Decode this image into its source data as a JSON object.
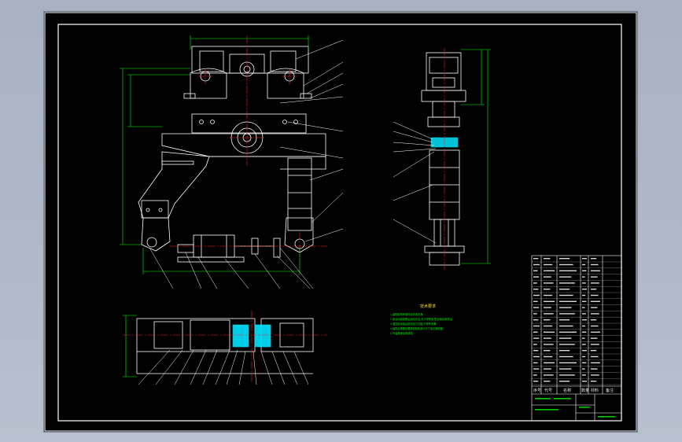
{
  "canvas": {
    "background": "#a9b3c4",
    "sheet_color": "#000000",
    "colors": {
      "outline": "#ffffff",
      "center_line": "#ff2020",
      "dimension": "#00ff00",
      "leader": "#ffffff",
      "hatch": "#00e5ff",
      "note_title": "#ffe000",
      "note_text": "#00ff00"
    }
  },
  "views": [
    {
      "name": "front-view"
    },
    {
      "name": "side-view"
    },
    {
      "name": "top-view"
    }
  ],
  "technical_notes": {
    "title": "技术要求",
    "lines": [
      "1.装配前所有零件应清洗干净。",
      "2.各运动副装配后运动灵活,无卡滞现象,配合面涂润滑油。",
      "3.液压缸安装后进行压力试验,不得有渗漏。",
      "4.装配后按图纸要求检验各部分尺寸及位置精度。",
      "5.外露表面涂防锈漆。"
    ]
  },
  "title_block": {
    "footer_labels": [
      "序号",
      "代号",
      "名称",
      "数量",
      "材料",
      "备注"
    ]
  }
}
